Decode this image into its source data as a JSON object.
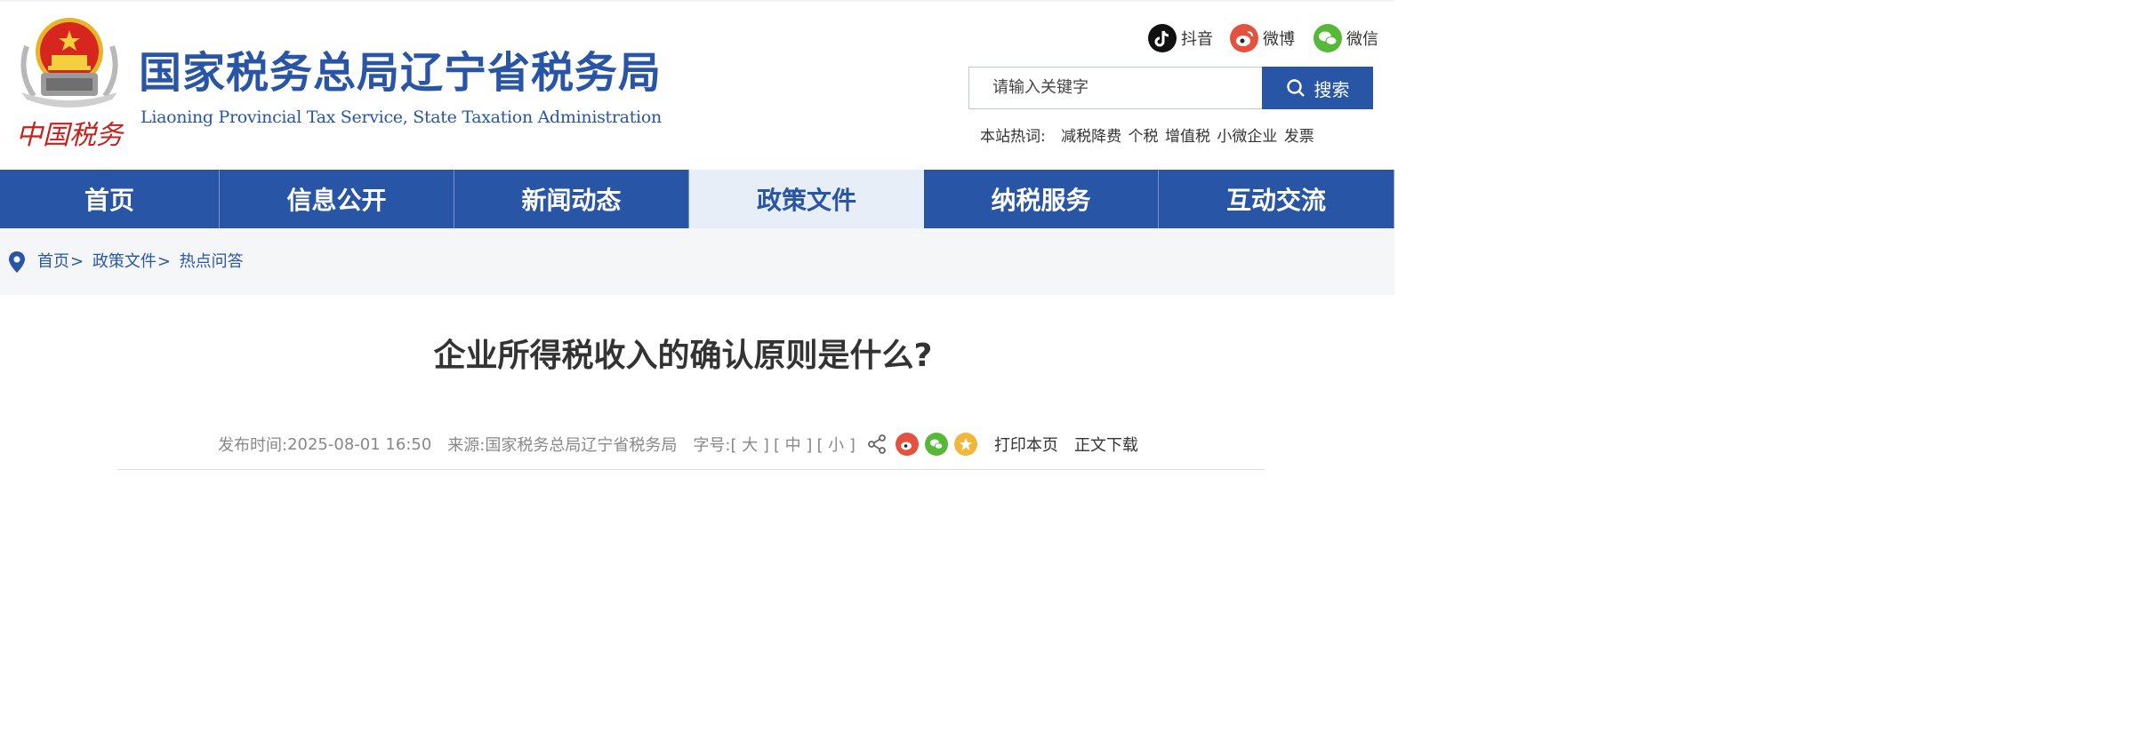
{
  "header": {
    "title_cn": "国家税务总局辽宁省税务局",
    "title_en": "Liaoning Provincial Tax Service, State Taxation Administration",
    "emblem_text": "中国税务",
    "social": [
      {
        "label": "抖音",
        "icon": "douyin-icon",
        "color": "#111111"
      },
      {
        "label": "微博",
        "icon": "weibo-icon",
        "color": "#e6503f"
      },
      {
        "label": "微信",
        "icon": "wechat-icon",
        "color": "#55b837"
      }
    ],
    "search": {
      "placeholder": "请输入关键字",
      "button_label": "搜索"
    },
    "hotwords": {
      "label": "本站热词:",
      "items": [
        "减税降费",
        "个税",
        "增值税",
        "小微企业",
        "发票"
      ]
    }
  },
  "nav": {
    "items": [
      {
        "label": "首页",
        "active": false
      },
      {
        "label": "信息公开",
        "active": false
      },
      {
        "label": "新闻动态",
        "active": false
      },
      {
        "label": "政策文件",
        "active": true
      },
      {
        "label": "纳税服务",
        "active": false
      },
      {
        "label": "互动交流",
        "active": false
      }
    ]
  },
  "breadcrumb": {
    "items": [
      "首页",
      "政策文件",
      "热点问答"
    ],
    "separator": ">"
  },
  "article": {
    "title": "企业所得税收入的确认原则是什么?",
    "publish_label": "发布时间:",
    "publish_time": "2025-08-01 16:50",
    "source_label": "来源:",
    "source": "国家税务总局辽宁省税务局",
    "font_size_label": "字号:",
    "font_sizes": [
      "[ 大 ]",
      "[ 中 ]",
      "[ 小 ]"
    ],
    "print_label": "打印本页",
    "download_label": "正文下载"
  },
  "colors": {
    "brand_blue": "#2855a5",
    "active_nav_bg": "#e8eef7",
    "crumb_bg": "#f5f6f8"
  }
}
